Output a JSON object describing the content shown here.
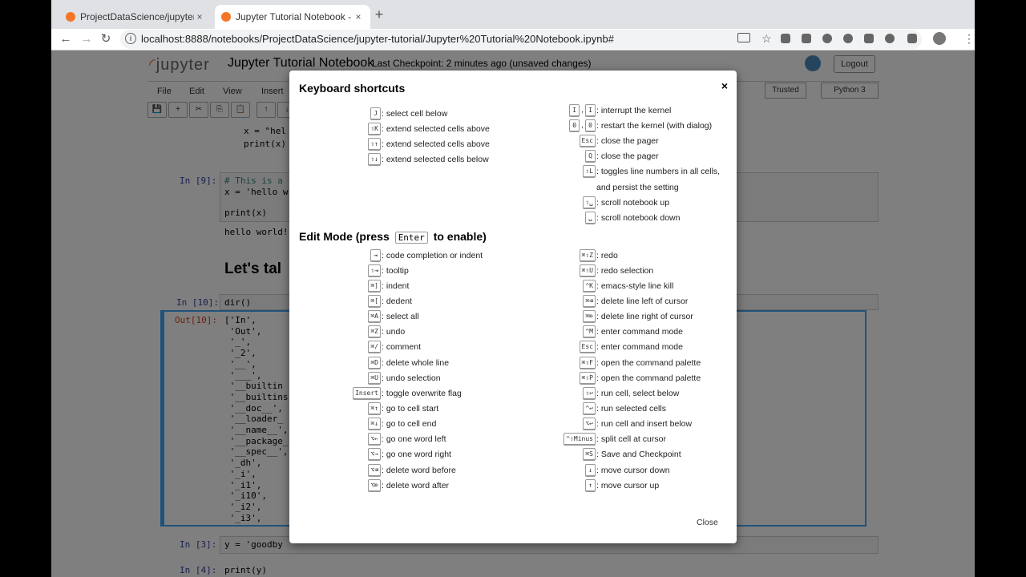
{
  "browser": {
    "tabs": [
      {
        "title": "ProjectDataScience/jupyter-tu",
        "close": "×"
      },
      {
        "title": "Jupyter Tutorial Notebook - Ju",
        "close": "×"
      }
    ],
    "new_tab": "+",
    "back": "←",
    "forward": "→",
    "reload": "↻",
    "url": "localhost:8888/notebooks/ProjectDataScience/jupyter-tutorial/Jupyter%20Tutorial%20Notebook.ipynb#",
    "star": "☆",
    "menu": "⋮"
  },
  "jupyter": {
    "logo": "jupyter",
    "title": "Jupyter Tutorial Notebook",
    "checkpoint": "Last Checkpoint: 2 minutes ago  (unsaved changes)",
    "logout": "Logout",
    "menu": [
      "File",
      "Edit",
      "View",
      "Insert"
    ],
    "trusted": "Trusted",
    "kernel": "Python 3",
    "toolbar_icons": [
      "💾",
      "+",
      "✂",
      "⎘",
      "📋",
      "↑",
      "↓"
    ],
    "cells": {
      "c1_line1": "x = \"hel",
      "c1_line2": "print(x)",
      "c2_prompt": "In [9]:",
      "c2_line1": "# This is a",
      "c2_line2": "x = 'hello w",
      "c2_line3": "print(x)",
      "c2_output": "hello world!",
      "heading": "Let's tal",
      "c3_prompt": "In [10]:",
      "c3_code": "dir()",
      "out_prompt": "Out[10]:",
      "out_lines": [
        "['In',",
        " 'Out',",
        " '_',",
        " '_2',",
        " '__',",
        " '___',",
        " '__builtin",
        " '__builtins",
        " '__doc__',",
        " '__loader_",
        " '__name__',",
        " '__package_",
        " '__spec__',",
        " '_dh',",
        " '_i',",
        " '_i1',",
        " '_i10',",
        " '_i2',",
        " '_i3',"
      ],
      "c4_prompt": "In [3]:",
      "c4_code": "y = 'goodby",
      "c5_prompt": "In [4]:",
      "c5_code": "print(y)"
    }
  },
  "modal": {
    "title": "Keyboard shortcuts",
    "close_x": "×",
    "edit_mode_prefix": "Edit Mode (press",
    "edit_mode_key": "Enter",
    "edit_mode_suffix": "to enable)",
    "close_label": "Close",
    "command_left": [
      {
        "keys": [
          "J"
        ],
        "desc": ": select cell below"
      },
      {
        "keys": [
          "⇧K"
        ],
        "desc": ": extend selected cells above"
      },
      {
        "keys": [
          "⇧↑"
        ],
        "desc": ": extend selected cells above"
      },
      {
        "keys": [
          "⇧↓"
        ],
        "desc": ": extend selected cells below"
      }
    ],
    "command_right": [
      {
        "keys": [
          "I",
          "I"
        ],
        "desc": ": interrupt the kernel"
      },
      {
        "keys": [
          "0",
          "0"
        ],
        "desc": ": restart the kernel (with dialog)"
      },
      {
        "keys": [
          "Esc"
        ],
        "desc": ": close the pager"
      },
      {
        "keys": [
          "Q"
        ],
        "desc": ": close the pager"
      },
      {
        "keys": [
          "⇧L"
        ],
        "desc": ": toggles line numbers in all cells,"
      },
      {
        "keys": [],
        "desc": "and persist the setting"
      },
      {
        "keys": [
          "⇧␣"
        ],
        "desc": ": scroll notebook up"
      },
      {
        "keys": [
          "␣"
        ],
        "desc": ": scroll notebook down"
      }
    ],
    "edit_left": [
      {
        "keys": [
          "⇥"
        ],
        "desc": ": code completion or indent"
      },
      {
        "keys": [
          "⇧⇥"
        ],
        "desc": ": tooltip"
      },
      {
        "keys": [
          "⌘]"
        ],
        "desc": ": indent"
      },
      {
        "keys": [
          "⌘["
        ],
        "desc": ": dedent"
      },
      {
        "keys": [
          "⌘A"
        ],
        "desc": ": select all"
      },
      {
        "keys": [
          "⌘Z"
        ],
        "desc": ": undo"
      },
      {
        "keys": [
          "⌘/"
        ],
        "desc": ": comment"
      },
      {
        "keys": [
          "⌘D"
        ],
        "desc": ": delete whole line"
      },
      {
        "keys": [
          "⌘U"
        ],
        "desc": ": undo selection"
      },
      {
        "keys": [
          "Insert"
        ],
        "desc": ": toggle overwrite flag"
      },
      {
        "keys": [
          "⌘↑"
        ],
        "desc": ": go to cell start"
      },
      {
        "keys": [
          "⌘↓"
        ],
        "desc": ": go to cell end"
      },
      {
        "keys": [
          "⌥←"
        ],
        "desc": ": go one word left"
      },
      {
        "keys": [
          "⌥→"
        ],
        "desc": ": go one word right"
      },
      {
        "keys": [
          "⌥⌫"
        ],
        "desc": ": delete word before"
      },
      {
        "keys": [
          "⌥⌦"
        ],
        "desc": ": delete word after"
      }
    ],
    "edit_right": [
      {
        "keys": [
          "⌘⇧Z"
        ],
        "desc": ": redo"
      },
      {
        "keys": [
          "⌘⇧U"
        ],
        "desc": ": redo selection"
      },
      {
        "keys": [
          "^K"
        ],
        "desc": ": emacs-style line kill"
      },
      {
        "keys": [
          "⌘⌫"
        ],
        "desc": ": delete line left of cursor"
      },
      {
        "keys": [
          "⌘⌦"
        ],
        "desc": ": delete line right of cursor"
      },
      {
        "keys": [
          "^M"
        ],
        "desc": ": enter command mode"
      },
      {
        "keys": [
          "Esc"
        ],
        "desc": ": enter command mode"
      },
      {
        "keys": [
          "⌘⇧F"
        ],
        "desc": ": open the command palette"
      },
      {
        "keys": [
          "⌘⇧P"
        ],
        "desc": ": open the command palette"
      },
      {
        "keys": [
          "⇧↩"
        ],
        "desc": ": run cell, select below"
      },
      {
        "keys": [
          "^↩"
        ],
        "desc": ": run selected cells"
      },
      {
        "keys": [
          "⌥↩"
        ],
        "desc": ": run cell and insert below"
      },
      {
        "keys": [
          "^⇧Minus"
        ],
        "desc": ": split cell at cursor"
      },
      {
        "keys": [
          "⌘S"
        ],
        "desc": ": Save and Checkpoint"
      },
      {
        "keys": [
          "↓"
        ],
        "desc": ": move cursor down"
      },
      {
        "keys": [
          "↑"
        ],
        "desc": ": move cursor up"
      }
    ]
  }
}
